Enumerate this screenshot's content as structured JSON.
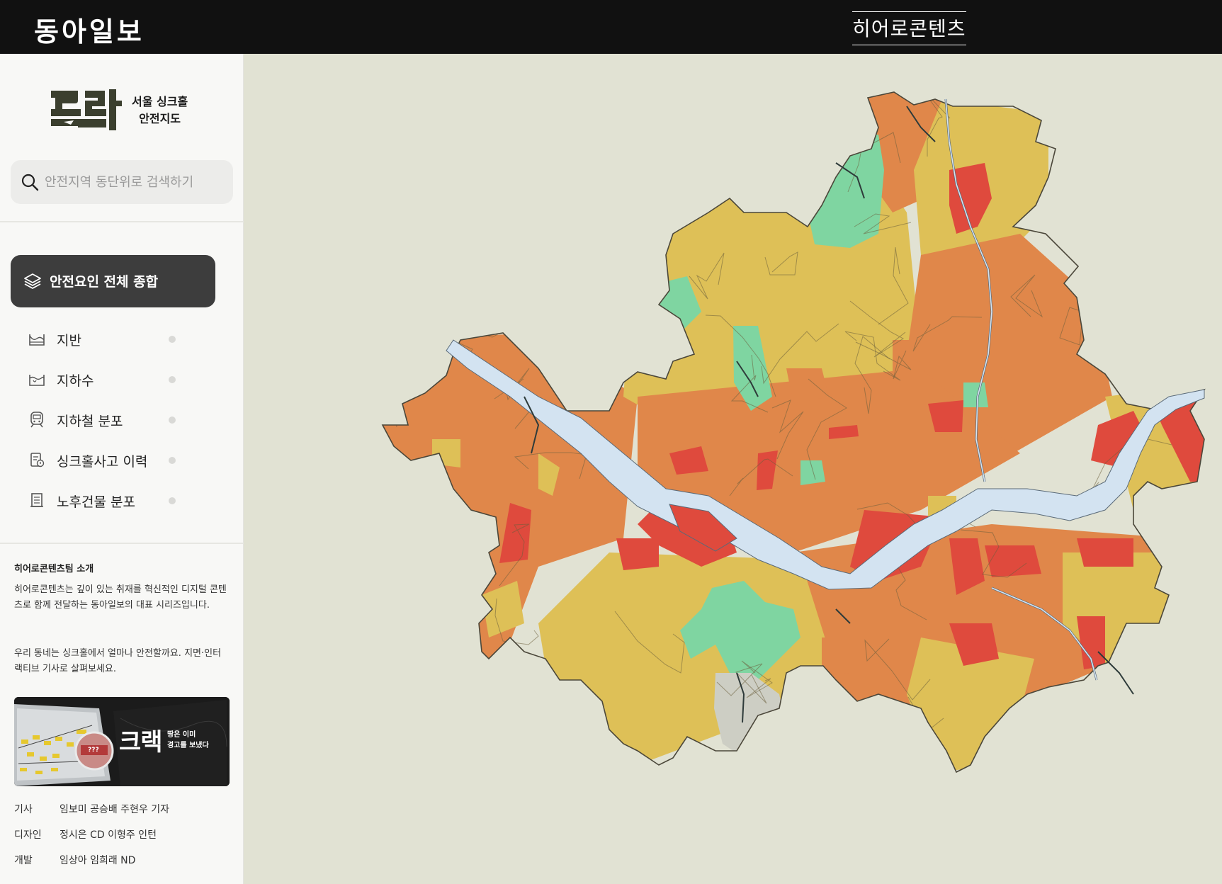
{
  "header": {
    "logo": "동아일보",
    "section_link": "히어로콘텐츠"
  },
  "sidebar": {
    "brand": {
      "mark": "크랙",
      "title_line1": "서울 싱크홀",
      "title_line2": "안전지도"
    },
    "search": {
      "placeholder": "안전지역 동단위로 검색하기",
      "value": ""
    },
    "all_button": "안전요인 전체 종합",
    "layers": [
      {
        "label": "지반",
        "icon": "ground-icon"
      },
      {
        "label": "지하수",
        "icon": "groundwater-icon"
      },
      {
        "label": "지하철 분포",
        "icon": "subway-icon"
      },
      {
        "label": "싱크홀사고 이력",
        "icon": "incident-report-icon"
      },
      {
        "label": "노후건물 분포",
        "icon": "old-building-icon"
      }
    ],
    "team": {
      "title": "히어로콘텐츠팀 소개",
      "p1": "히어로콘텐츠는 깊이 있는 취재를 혁신적인 디지털 콘텐츠로 함께 전달하는 동아일보의 대표 시리즈입니다.",
      "p2": "우리 동네는 싱크홀에서 얼마나 안전할까요. 지면·인터랙티브 기사로 살펴보세요."
    },
    "banner": {
      "title": "크랙",
      "sub_line1": "땅은 이미",
      "sub_line2": "경고를 보냈다",
      "badge": "???"
    },
    "credits": [
      {
        "role": "기사",
        "names": "임보미 공승배 주현우 기자"
      },
      {
        "role": "디자인",
        "names": "정시은 CD 이형주 인턴"
      },
      {
        "role": "개발",
        "names": "임상아 임희래 ND"
      }
    ]
  },
  "map": {
    "colors": {
      "background": "#e1e2d3",
      "river": "#d3e3f1",
      "boundary": "#6b5e3c",
      "stream": "#2e3b3a"
    },
    "legend_palette": [
      "#df4a3d",
      "#e0874a",
      "#dec057",
      "#7fd5a1",
      "#cdcec4"
    ]
  }
}
